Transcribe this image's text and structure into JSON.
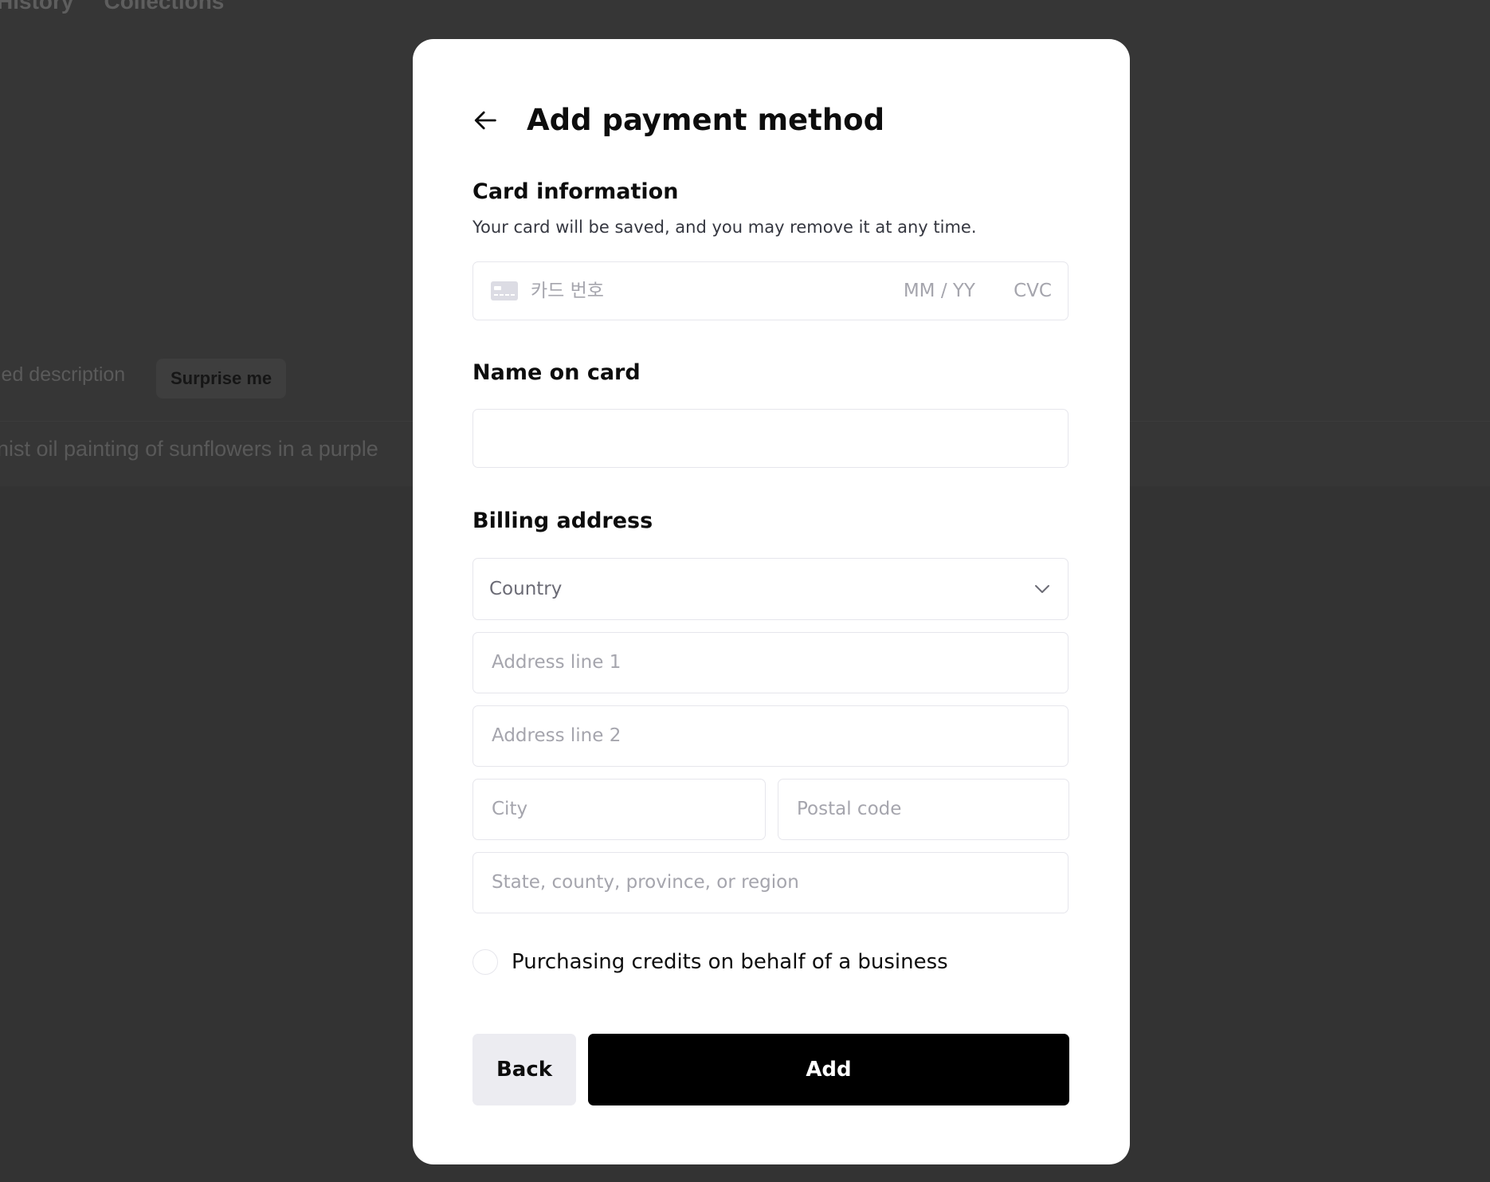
{
  "background": {
    "nav": [
      "History",
      "Collections"
    ],
    "hint_text": "led description",
    "surprise_label": "Surprise me",
    "prompt_text": "nist oil painting of sunflowers in a purple"
  },
  "modal": {
    "title": "Add payment method",
    "card_section": {
      "label": "Card information",
      "helper": "Your card will be saved, and you may remove it at any time.",
      "number_placeholder": "카드 번호",
      "expiry_placeholder": "MM / YY",
      "cvc_placeholder": "CVC",
      "icon": "credit-card-icon"
    },
    "name_section": {
      "label": "Name on card",
      "value": ""
    },
    "billing_section": {
      "label": "Billing address",
      "country_placeholder": "Country",
      "address1_placeholder": "Address line 1",
      "address2_placeholder": "Address line 2",
      "city_placeholder": "City",
      "postal_placeholder": "Postal code",
      "region_placeholder": "State, county, province, or region"
    },
    "business_checkbox": {
      "label": "Purchasing credits on behalf of a business",
      "checked": false
    },
    "buttons": {
      "back": "Back",
      "add": "Add"
    }
  },
  "colors": {
    "overlay": "#343434",
    "modal_bg": "#ffffff",
    "primary_button": "#000000",
    "secondary_button": "#ececf1",
    "field_border": "#e6e6ec",
    "placeholder": "#a5a5ad"
  }
}
